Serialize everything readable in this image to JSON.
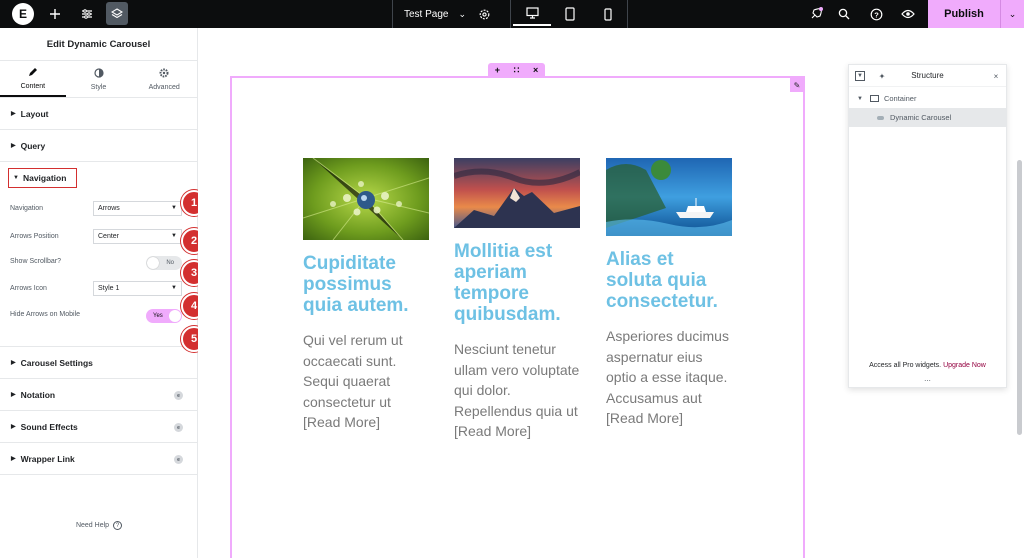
{
  "topbar": {
    "logo": "E",
    "page_title": "Test Page",
    "publish_label": "Publish"
  },
  "panel": {
    "title": "Edit Dynamic Carousel",
    "tabs": [
      {
        "label": "Content",
        "icon": "pencil-icon"
      },
      {
        "label": "Style",
        "icon": "half-circle-icon"
      },
      {
        "label": "Advanced",
        "icon": "gear-icon"
      }
    ],
    "sections_top": [
      "Layout",
      "Query"
    ],
    "navigation": {
      "title": "Navigation",
      "controls": {
        "navigation": {
          "label": "Navigation",
          "value": "Arrows"
        },
        "arrows_position": {
          "label": "Arrows Position",
          "value": "Center"
        },
        "show_scrollbar": {
          "label": "Show Scrollbar?",
          "value": "No"
        },
        "arrows_icon": {
          "label": "Arrows Icon",
          "value": "Style 1"
        },
        "hide_arrows_mobile": {
          "label": "Hide Arrows on Mobile",
          "value": "Yes"
        }
      },
      "markers": [
        "1",
        "2",
        "3",
        "4",
        "5"
      ]
    },
    "sections_bottom": [
      "Carousel Settings",
      "Notation",
      "Sound Effects",
      "Wrapper Link"
    ],
    "need_help": "Need Help"
  },
  "cards": [
    {
      "title": "Cupiditate possimus quia autem.",
      "text": "Qui vel rerum ut occaecati sunt. Sequi quaerat consectetur ut [Read More]",
      "image": "water-drops-leaf"
    },
    {
      "title": "Mollitia est aperiam tempore quibusdam.",
      "text": "Nesciunt tenetur ullam vero voluptate qui dolor. Repellendus quia ut [Read More]",
      "image": "mountain-sunset"
    },
    {
      "title": "Alias et soluta quia consectetur.",
      "text": "Asperiores ducimus aspernatur eius optio a esse itaque. Accusamus aut [Read More]",
      "image": "yacht-sea"
    }
  ],
  "structure": {
    "title": "Structure",
    "tree": [
      {
        "label": "Container"
      },
      {
        "label": "Dynamic Carousel"
      }
    ],
    "footer_text": "Access all Pro widgets.",
    "footer_link": "Upgrade Now",
    "footer_dots": "..."
  },
  "colors": {
    "accent_pink": "#f0abfc",
    "heading_blue": "#6ec1e4",
    "marker_red": "#d32f2f",
    "topbar_bg": "#0c0d0e"
  }
}
